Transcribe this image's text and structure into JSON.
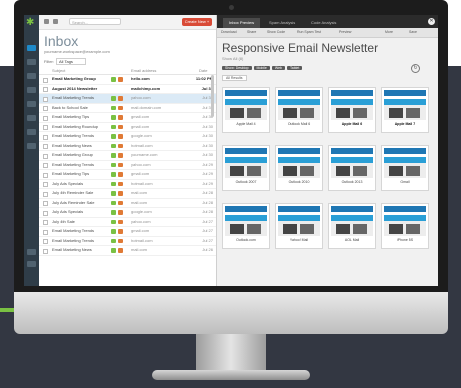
{
  "inbox": {
    "search_placeholder": "Search...",
    "create_button": "Create New +",
    "title": "Inbox",
    "account_email": "yourname.workspace@example.com",
    "filter_label": "Filter:",
    "filter_value": "All Tags",
    "columns": [
      "Subject",
      "Email address",
      "Date"
    ],
    "rows": [
      {
        "subject": "Email Marketing Group",
        "from": "hello.com",
        "date": "11:02 PM",
        "bold": true,
        "badges": [
          "#7ac143",
          "#e07a36"
        ]
      },
      {
        "subject": "August 2014 Newsletter",
        "from": "mailchimp.com",
        "date": "Jul 31",
        "bold": true,
        "badges": []
      },
      {
        "subject": "Email Marketing Trends",
        "from": "yahoo.com",
        "date": "Jul 31",
        "bold": false,
        "selected": true,
        "badges": [
          "#7ac143",
          "#e07a36"
        ]
      },
      {
        "subject": "Back to School Sale",
        "from": "mail.domain.com",
        "date": "Jul 31",
        "bold": false,
        "badges": [
          "#7ac143",
          "#e07a36"
        ]
      },
      {
        "subject": "Email Marketing Tips",
        "from": "gmail.com",
        "date": "Jul 30",
        "bold": false,
        "badges": [
          "#7ac143",
          "#e07a36"
        ]
      },
      {
        "subject": "Email Marketing Roundup",
        "from": "gmail.com",
        "date": "Jul 30",
        "bold": false,
        "badges": [
          "#7ac143",
          "#e07a36"
        ]
      },
      {
        "subject": "Email Marketing Trends",
        "from": "google.com",
        "date": "Jul 30",
        "bold": false,
        "badges": [
          "#7ac143",
          "#e07a36"
        ]
      },
      {
        "subject": "Email Marketing News",
        "from": "hotmail.com",
        "date": "Jul 30",
        "bold": false,
        "badges": [
          "#7ac143",
          "#e07a36"
        ]
      },
      {
        "subject": "Email Marketing Group",
        "from": "yourname.com",
        "date": "Jul 30",
        "bold": false,
        "badges": [
          "#7ac143",
          "#e07a36"
        ]
      },
      {
        "subject": "Email Marketing Trends",
        "from": "yahoo.com",
        "date": "Jul 29",
        "bold": false,
        "badges": [
          "#7ac143",
          "#e07a36"
        ]
      },
      {
        "subject": "Email Marketing Tips",
        "from": "gmail.com",
        "date": "Jul 29",
        "bold": false,
        "badges": [
          "#7ac143",
          "#e07a36"
        ]
      },
      {
        "subject": "July Ads Specials",
        "from": "hotmail.com",
        "date": "Jul 29",
        "bold": false,
        "badges": [
          "#7ac143",
          "#e07a36"
        ]
      },
      {
        "subject": "July 4th Reminder Sale",
        "from": "mail.com",
        "date": "Jul 28",
        "bold": false,
        "badges": [
          "#7ac143",
          "#e07a36"
        ]
      },
      {
        "subject": "July Ads Reminder Sale",
        "from": "mail.com",
        "date": "Jul 28",
        "bold": false,
        "badges": [
          "#7ac143",
          "#e07a36"
        ]
      },
      {
        "subject": "July Ads Specials",
        "from": "google.com",
        "date": "Jul 28",
        "bold": false,
        "badges": [
          "#7ac143",
          "#e07a36"
        ]
      },
      {
        "subject": "July 4th Sale",
        "from": "yahoo.com",
        "date": "Jul 27",
        "bold": false,
        "badges": [
          "#7ac143",
          "#e07a36"
        ]
      },
      {
        "subject": "Email Marketing Trends",
        "from": "gmail.com",
        "date": "Jul 27",
        "bold": false,
        "badges": [
          "#7ac143",
          "#e07a36"
        ]
      },
      {
        "subject": "Email Marketing Trends",
        "from": "hotmail.com",
        "date": "Jul 27",
        "bold": false,
        "badges": [
          "#7ac143",
          "#e07a36"
        ]
      },
      {
        "subject": "Email Marketing News",
        "from": "mail.com",
        "date": "Jul 26",
        "bold": false,
        "badges": [
          "#7ac143",
          "#e07a36"
        ]
      }
    ]
  },
  "preview": {
    "tabs": [
      "Inbox Preview",
      "Spam Analysis",
      "Code Analysis"
    ],
    "toolbar": [
      "Download",
      "Share",
      "Show Code",
      "Run Spam Test",
      "Preview",
      "More",
      "Save"
    ],
    "title": "Responsive Email Newsletter",
    "subtitle": "Show All (8)",
    "filters": [
      "Show: Desktop",
      "Mobile",
      "Web",
      "Tablet"
    ],
    "select_all": "All Results",
    "thumbnails": [
      {
        "label": "Apple Mail 4",
        "highlight": false
      },
      {
        "label": "Outlook Mail 6",
        "highlight": false
      },
      {
        "label": "Apple Mail 6",
        "highlight": true
      },
      {
        "label": "Apple Mail 7",
        "highlight": true
      },
      {
        "label": "Outlook 2007",
        "highlight": false
      },
      {
        "label": "Outlook 2010",
        "highlight": false
      },
      {
        "label": "Outlook 2013",
        "highlight": false
      },
      {
        "label": "Gmail",
        "highlight": false
      },
      {
        "label": "Outlook.com",
        "highlight": false
      },
      {
        "label": "Yahoo! Mail",
        "highlight": false
      },
      {
        "label": "AOL Mail",
        "highlight": false
      },
      {
        "label": "iPhone 5S",
        "highlight": false
      }
    ]
  },
  "colors": {
    "accent": "#7ac143",
    "nav": "#2f3d48",
    "create": "#d94b37",
    "select": "#dbeaf6"
  }
}
